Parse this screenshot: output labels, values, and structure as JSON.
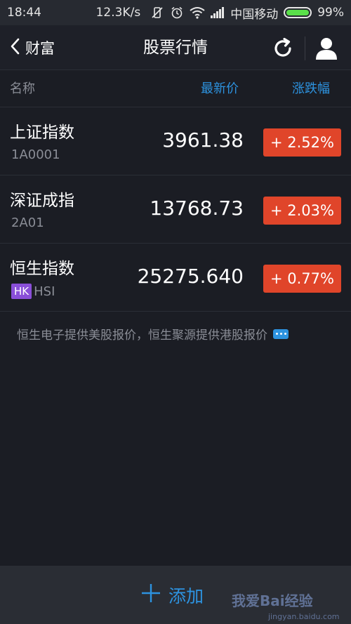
{
  "status_bar": {
    "time": "18:44",
    "network_speed": "12.3K/s",
    "carrier": "中国移动",
    "battery": "99%",
    "battery_level": 0.99
  },
  "nav": {
    "back_label": "财富",
    "title": "股票行情"
  },
  "table_header": {
    "name": "名称",
    "price": "最新价",
    "change": "涨跌幅"
  },
  "stocks": [
    {
      "name": "上证指数",
      "code": "1A0001",
      "price": "3961.38",
      "change": "+ 2.52%"
    },
    {
      "name": "深证成指",
      "code": "2A01",
      "price": "13768.73",
      "change": "+ 2.03%"
    },
    {
      "name": "恒生指数",
      "tag": "HK",
      "code": "HSI",
      "price": "25275.640",
      "change": "+ 0.77%"
    }
  ],
  "notice": "恒生电子提供美股报价，恒生聚源提供港股报价",
  "bottom": {
    "add_label": "添加"
  },
  "watermark": {
    "line1": "我爱Bai经验",
    "line2": "jingyan.baidu.com"
  },
  "colors": {
    "background": "#1b1d24",
    "accent": "#2d93e0",
    "rise": "#e0452a",
    "hk_tag": "#8a4fd8"
  }
}
